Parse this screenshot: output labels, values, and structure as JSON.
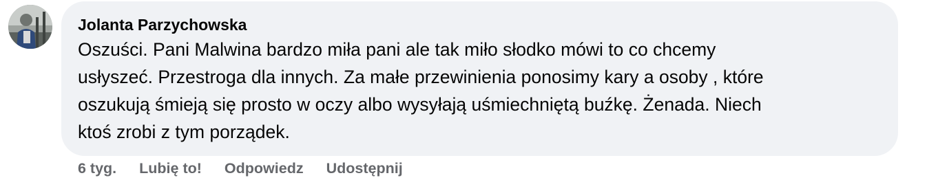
{
  "comment": {
    "author": "Jolanta Parzychowska",
    "text": "Oszuści. Pani Malwina bardzo miła pani ale tak miło słodko mówi to co chcemy\nusłyszeć. Przestroga dla innych. Za małe przewinienia ponosimy kary a osoby , które\noszukują śmieją się prosto w oczy albo wysyłają uśmiechniętą buźkę. Żenada. Niech\nktoś zrobi z tym porządek.",
    "timestamp": "6 tyg.",
    "actions": {
      "like": "Lubię to!",
      "reply": "Odpowiedz",
      "share": "Udostępnij"
    }
  },
  "colors": {
    "bubble": "#f0f2f5",
    "text": "#050505",
    "muted": "#65676b"
  }
}
